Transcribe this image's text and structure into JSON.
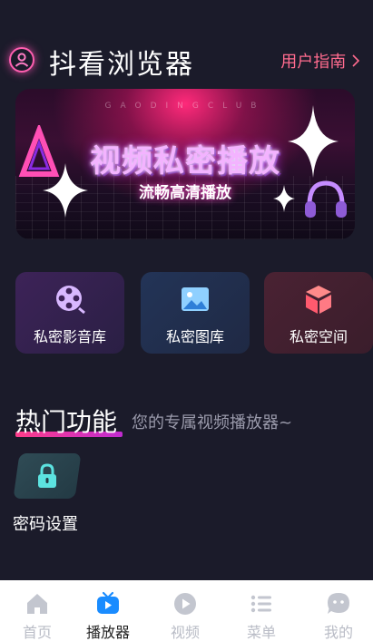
{
  "header": {
    "title": "抖看浏览器",
    "guide_label": "用户指南",
    "guide_icon": "chevron-right-icon",
    "profile_icon": "user-circle-icon"
  },
  "banner": {
    "club_text": "GAODINGCLUB",
    "title": "视频私密播放",
    "subtitle": "流畅高清播放"
  },
  "quick_actions": [
    {
      "label": "私密影音库",
      "icon": "film-reel-icon"
    },
    {
      "label": "私密图库",
      "icon": "image-icon"
    },
    {
      "label": "私密空间",
      "icon": "cube-icon"
    }
  ],
  "hot_features": {
    "title": "热门功能",
    "subtitle": "您的专属视频播放器~",
    "items": [
      {
        "label": "密码设置",
        "icon": "lock-icon"
      }
    ]
  },
  "tabbar": {
    "items": [
      {
        "label": "首页",
        "icon": "home-icon",
        "active": false
      },
      {
        "label": "播放器",
        "icon": "tv-play-icon",
        "active": true
      },
      {
        "label": "视频",
        "icon": "play-circle-icon",
        "active": false
      },
      {
        "label": "菜单",
        "icon": "list-icon",
        "active": false
      },
      {
        "label": "我的",
        "icon": "chat-face-icon",
        "active": false
      }
    ]
  },
  "colors": {
    "background": "#1b1b2a",
    "accent_pink": "#ff6b8e",
    "tab_active": "#1a8cff",
    "tab_inactive": "#b9bcc6"
  }
}
